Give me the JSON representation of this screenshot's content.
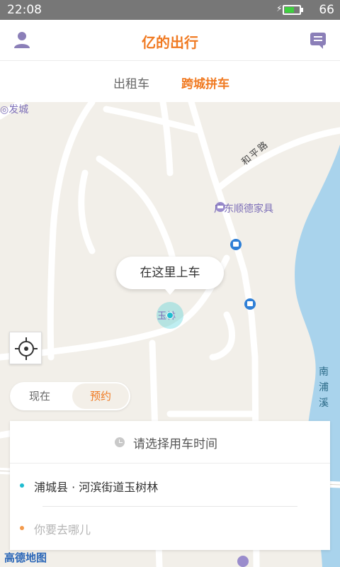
{
  "status_bar": {
    "time": "22:08",
    "battery_level": "66",
    "battery_fill": 0.66
  },
  "header": {
    "title": "亿的出行",
    "left_icon": "user-icon",
    "right_icon": "message-icon"
  },
  "tabs": [
    {
      "label": "出租车",
      "active": false
    },
    {
      "label": "跨城拼车",
      "active": true
    }
  ],
  "map": {
    "poi_top_left": "◎发城",
    "poi_furniture": "广东顺德家具",
    "road_label": "和平路",
    "river_label": "南浦溪",
    "pin_label": "玉林",
    "pickup_bubble": "在这里上车",
    "attribution": "高德地图"
  },
  "time_toggle": {
    "now": "现在",
    "book": "预约",
    "selected": "预约"
  },
  "panel": {
    "time_prompt": "请选择用车时间",
    "from": "浦城县 · 河滨街道玉树林",
    "to_placeholder": "你要去哪儿"
  },
  "colors": {
    "accent": "#f07a22",
    "pickup_dot": "#20bcd0",
    "dest_dot": "#f39a4c",
    "water": "#a9d3ec"
  }
}
